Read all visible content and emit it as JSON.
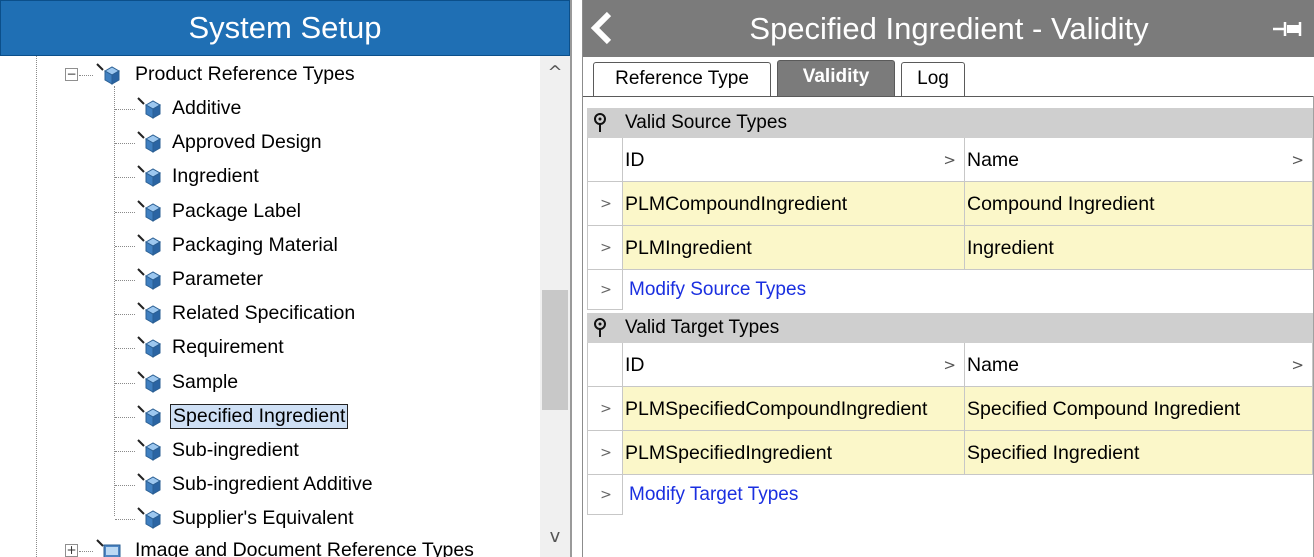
{
  "left_pane": {
    "title": "System Setup",
    "tree": {
      "parent_label": "Product Reference Types",
      "children": [
        "Additive",
        "Approved Design",
        "Ingredient",
        "Package Label",
        "Packaging Material",
        "Parameter",
        "Related Specification",
        "Requirement",
        "Sample",
        "Specified Ingredient",
        "Sub-ingredient",
        "Sub-ingredient Additive",
        "Supplier's Equivalent"
      ],
      "selected": "Specified Ingredient",
      "next_sibling_label": "Image and Document Reference Types"
    },
    "scroll_up_glyph": "^",
    "scroll_down_glyph": "v",
    "expander_collapse": "−",
    "expander_expand": "+"
  },
  "right_pane": {
    "title": "Specified Ingredient - Validity",
    "back_icon": "chevron-left-icon",
    "pin_icon": "pin-icon",
    "tabs": [
      {
        "label": "Reference Type",
        "active": false
      },
      {
        "label": "Validity",
        "active": true
      },
      {
        "label": "Log",
        "active": false
      }
    ],
    "source_section": {
      "title": "Valid Source Types",
      "columns": [
        "ID",
        "Name"
      ],
      "rows": [
        {
          "id": "PLMCompoundIngredient",
          "name": "Compound Ingredient"
        },
        {
          "id": "PLMIngredient",
          "name": "Ingredient"
        }
      ],
      "modify_link": "Modify Source Types"
    },
    "target_section": {
      "title": "Valid Target Types",
      "columns": [
        "ID",
        "Name"
      ],
      "rows": [
        {
          "id": "PLMSpecifiedCompoundIngredient",
          "name": "Specified Compound Ingredient"
        },
        {
          "id": "PLMSpecifiedIngredient",
          "name": "Specified Ingredient"
        }
      ],
      "modify_link": "Modify Target Types"
    },
    "row_glyph": ">",
    "sort_glyph": ">"
  },
  "colors": {
    "left_header_bg": "#1f6fb4",
    "right_header_bg": "#7b7b7b",
    "data_cell_bg": "#fbf7c9",
    "selection_bg": "#cfe0f5",
    "link": "#1a2fe0"
  }
}
